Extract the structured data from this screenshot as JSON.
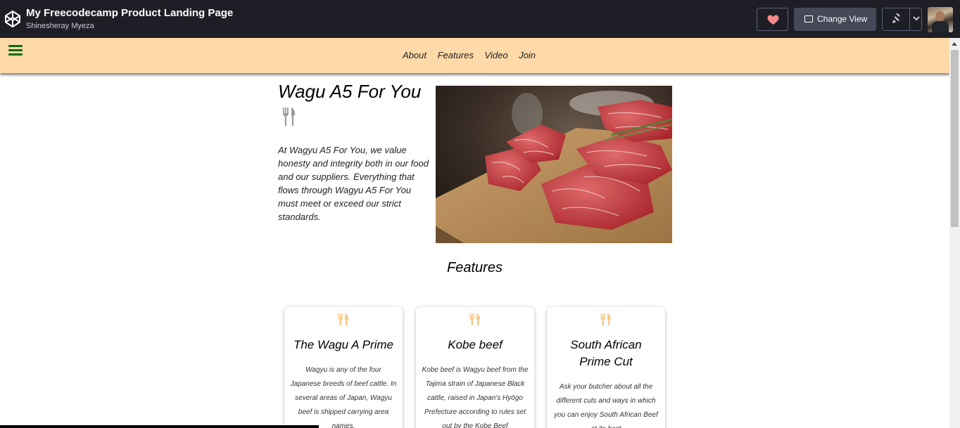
{
  "codepen": {
    "title": "My Freecodecamp Product Landing Page",
    "author": "Shinesheray Myeza",
    "change_view_label": "Change View",
    "icons": [
      "codepen-logo-icon",
      "heart-icon",
      "change-view-icon",
      "pin-icon",
      "chevron-down-icon"
    ]
  },
  "site": {
    "nav_links": [
      "About",
      "Features",
      "Video",
      "Join"
    ],
    "hero_title": "Wagu A5 For You",
    "hero_text": "At Wagyu A5 For You, we value honesty and integrity both in our food and our suppliers. Everything that flows through Wagyu A5 For You must meet or exceed our strict standards.",
    "features_title": "Features",
    "cards": [
      {
        "title": "The Wagu A Prime",
        "text": "Wagyu is any of the four Japanese breeds of beef cattle. In several areas of Japan, Wagyu beef is shipped carrying area names."
      },
      {
        "title": "Kobe beef",
        "text": "Kobe beef is Wagyu beef from the Tajima strain of Japanese Black cattle, raised in Japan's Hyōgo Prefecture according to rules set out by the Kobe Beef"
      },
      {
        "title": "South African Prime Cut",
        "text": "Ask your butcher about all the different cuts and ways in which you can enjoy South African Beef at its best"
      }
    ]
  },
  "colors": {
    "codepen_bar": "#1e1f26",
    "nav_background": "#ffd9a8",
    "hamburger": "#0a6b12",
    "card_icon": "#f6c98c",
    "heart": "#f38b8b"
  }
}
